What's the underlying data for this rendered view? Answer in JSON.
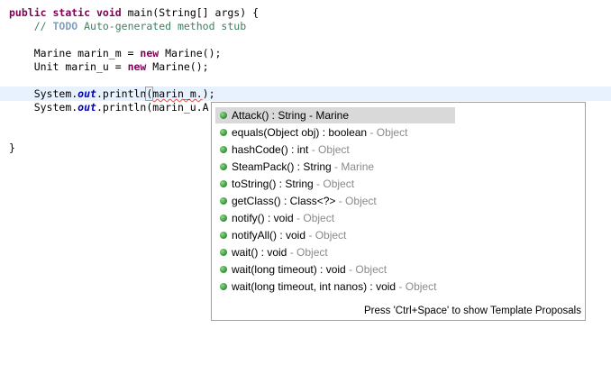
{
  "code": {
    "line1": {
      "kw1": "public",
      "kw2": "static",
      "kw3": "void",
      "rest": " main(String[] args) {"
    },
    "line2": {
      "comment_start": "// ",
      "todo": "TODO",
      "comment_end": " Auto-generated method stub"
    },
    "line4": {
      "a": "Marine marin_m = ",
      "kw": "new",
      "b": " Marine();"
    },
    "line5": {
      "a": "Unit marin_u = ",
      "kw": "new",
      "b": " Marine();"
    },
    "line7": {
      "a": "System.",
      "out": "out",
      "b": ".println",
      "paren": "(",
      "arg": "marin_m.",
      "c": ");"
    },
    "line8": {
      "a": "System.",
      "out": "out",
      "b": ".println(marin_u.A"
    },
    "line10": {
      "brace": "}"
    }
  },
  "proposals": [
    {
      "name": "Attack() : String",
      "decl": " - Marine",
      "selected": true
    },
    {
      "name": "equals(Object obj) : boolean",
      "decl": " - Object"
    },
    {
      "name": "hashCode() : int",
      "decl": " - Object"
    },
    {
      "name": "SteamPack() : String",
      "decl": " - Marine"
    },
    {
      "name": "toString() : String",
      "decl": " - Object"
    },
    {
      "name": "getClass() : Class<?>",
      "decl": " - Object"
    },
    {
      "name": "notify() : void",
      "decl": " - Object"
    },
    {
      "name": "notifyAll() : void",
      "decl": " - Object"
    },
    {
      "name": "wait() : void",
      "decl": " - Object"
    },
    {
      "name": "wait(long timeout) : void",
      "decl": " - Object"
    },
    {
      "name": "wait(long timeout, int nanos) : void",
      "decl": " - Object"
    }
  ],
  "footer": {
    "hint": "Press 'Ctrl+Space' to show Template Proposals"
  },
  "colors": {
    "keyword": "#7f0055",
    "comment": "#3f7f5f",
    "selection": "#d9d9d9",
    "current_line": "#e8f2fe"
  },
  "icons": {
    "proposal_icon": "public-method-icon"
  }
}
